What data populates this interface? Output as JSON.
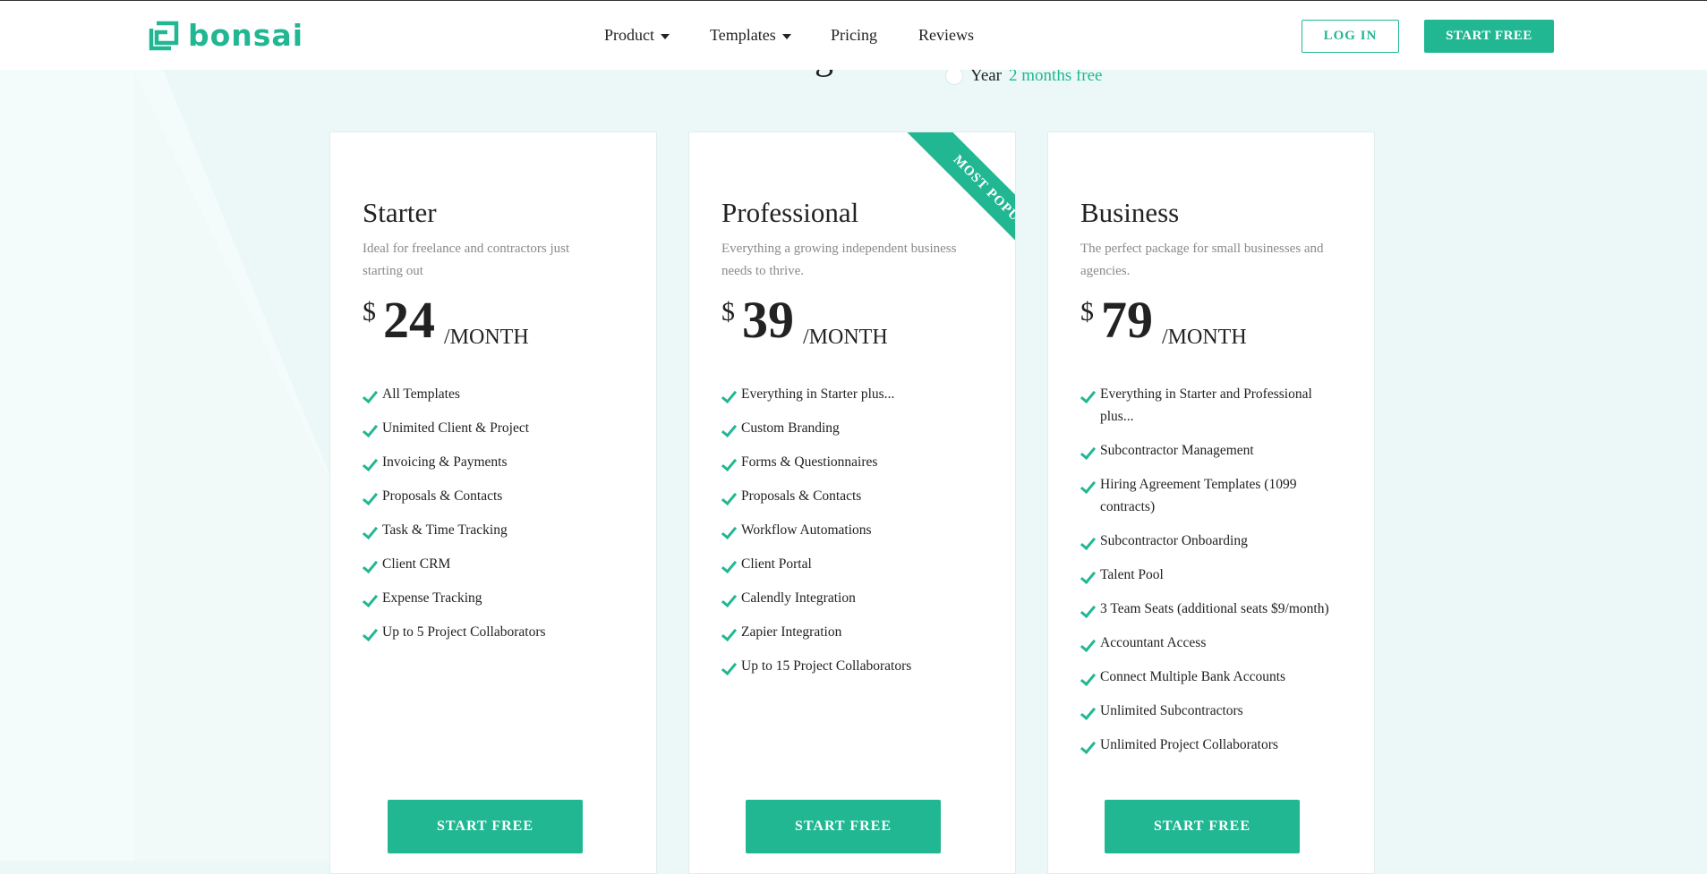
{
  "brand": {
    "name": "bonsai",
    "accent": "#21b792"
  },
  "nav": {
    "items": [
      {
        "label": "Product",
        "dropdown": true
      },
      {
        "label": "Templates",
        "dropdown": true
      },
      {
        "label": "Pricing",
        "dropdown": false
      },
      {
        "label": "Reviews",
        "dropdown": false
      }
    ],
    "login_label": "LOG IN",
    "start_label": "START FREE"
  },
  "hero": {
    "title": "Plans & Pricing",
    "billing_option": "Year",
    "billing_promo": "2 months free"
  },
  "plans": [
    {
      "name": "Starter",
      "description": "Ideal for freelance and contractors just starting out",
      "currency": "$",
      "price": "24",
      "period": "/MONTH",
      "features": [
        "All Templates",
        "Unimited Client & Project",
        "Invoicing & Payments",
        "Proposals & Contacts",
        "Task & Time Tracking",
        "Client CRM",
        "Expense Tracking",
        "Up to 5 Project Collaborators"
      ],
      "cta": "START FREE"
    },
    {
      "name": "Professional",
      "description": "Everything a growing independent business needs to thrive.",
      "currency": "$",
      "price": "39",
      "period": "/MONTH",
      "badge": "MOST POPULAR",
      "features": [
        "Everything in Starter plus...",
        "Custom Branding",
        "Forms & Questionnaires",
        "Proposals & Contacts",
        "Workflow Automations",
        "Client Portal",
        "Calendly Integration",
        "Zapier Integration",
        "Up to 15 Project Collaborators"
      ],
      "cta": "START FREE"
    },
    {
      "name": "Business",
      "description": "The perfect package for small businesses and agencies.",
      "currency": "$",
      "price": "79",
      "period": "/MONTH",
      "features": [
        "Everything in Starter and Professional plus...",
        "Subcontractor Management",
        "Hiring Agreement Templates (1099 contracts)",
        "Subcontractor Onboarding",
        "Talent Pool",
        "3 Team Seats (additional seats $9/month)",
        "Accountant Access",
        "Connect Multiple Bank Accounts",
        "Unlimited Subcontractors",
        "Unlimited Project Collaborators"
      ],
      "cta": "START FREE"
    }
  ]
}
